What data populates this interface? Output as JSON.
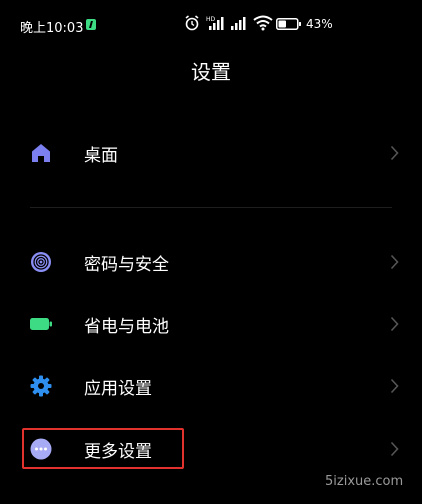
{
  "status_bar": {
    "time": "晚上10:03",
    "battery_percent": "43%",
    "icons": [
      "charging-badge-icon",
      "alarm-icon",
      "hd-signal-icon",
      "signal-icon",
      "wifi-icon",
      "battery-icon"
    ]
  },
  "header": {
    "title": "设置"
  },
  "settings": {
    "items": [
      {
        "label": "桌面",
        "icon": "home-icon",
        "color": "#7b7ff0"
      },
      {
        "label": "密码与安全",
        "icon": "fingerprint-icon",
        "color": "#8a8ff5"
      },
      {
        "label": "省电与电池",
        "icon": "battery-icon",
        "color": "#3ddc84"
      },
      {
        "label": "应用设置",
        "icon": "gear-icon",
        "color": "#2e8ff0"
      },
      {
        "label": "更多设置",
        "icon": "more-icon",
        "color": "#a7aaf5"
      }
    ]
  },
  "annotation": {
    "highlight_color": "#e2322e"
  },
  "watermark": "5izixue.com"
}
